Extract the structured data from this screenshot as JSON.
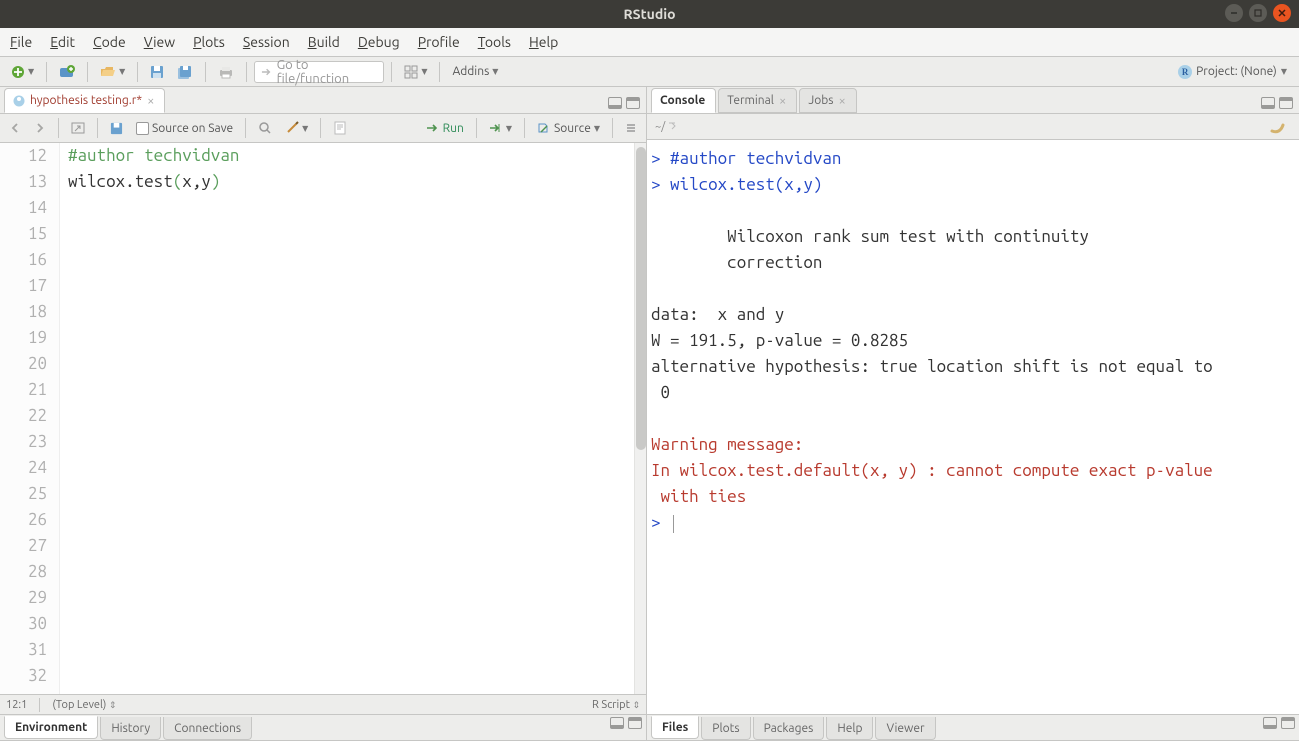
{
  "window": {
    "title": "RStudio"
  },
  "menubar": [
    "File",
    "Edit",
    "Code",
    "View",
    "Plots",
    "Session",
    "Build",
    "Debug",
    "Profile",
    "Tools",
    "Help"
  ],
  "toolbar": {
    "goto_placeholder": "Go to file/function",
    "addins_label": "Addins",
    "project_label": "Project: (None)"
  },
  "source": {
    "tab_name": "hypothesis testing.r*",
    "source_on_save": "Source on Save",
    "run_label": "Run",
    "source_label": "Source",
    "first_line": 12,
    "lines": [
      {
        "n": 12,
        "type": "comment",
        "text": "#author techvidvan"
      },
      {
        "n": 13,
        "type": "code",
        "text": "wilcox.test(x,y)"
      },
      {
        "n": 14,
        "type": "blank",
        "text": ""
      },
      {
        "n": 15,
        "type": "blank",
        "text": ""
      },
      {
        "n": 16,
        "type": "blank",
        "text": ""
      },
      {
        "n": 17,
        "type": "blank",
        "text": ""
      },
      {
        "n": 18,
        "type": "blank",
        "text": ""
      },
      {
        "n": 19,
        "type": "blank",
        "text": ""
      },
      {
        "n": 20,
        "type": "blank",
        "text": ""
      },
      {
        "n": 21,
        "type": "blank",
        "text": ""
      },
      {
        "n": 22,
        "type": "blank",
        "text": ""
      },
      {
        "n": 23,
        "type": "blank",
        "text": ""
      },
      {
        "n": 24,
        "type": "blank",
        "text": ""
      },
      {
        "n": 25,
        "type": "blank",
        "text": ""
      },
      {
        "n": 26,
        "type": "blank",
        "text": ""
      },
      {
        "n": 27,
        "type": "blank",
        "text": ""
      },
      {
        "n": 28,
        "type": "blank",
        "text": ""
      },
      {
        "n": 29,
        "type": "blank",
        "text": ""
      },
      {
        "n": 30,
        "type": "blank",
        "text": ""
      },
      {
        "n": 31,
        "type": "blank",
        "text": ""
      },
      {
        "n": 32,
        "type": "blank",
        "text": ""
      }
    ],
    "status_cursor": "12:1",
    "status_scope": "(Top Level)",
    "status_lang": "R Script"
  },
  "console": {
    "tabs": [
      "Console",
      "Terminal",
      "Jobs"
    ],
    "path": "~/",
    "lines": [
      {
        "cls": "prompt",
        "text": "> #author techvidvan"
      },
      {
        "cls": "prompt",
        "text": "> wilcox.test(x,y)"
      },
      {
        "cls": "out",
        "text": ""
      },
      {
        "cls": "out",
        "text": "        Wilcoxon rank sum test with continuity"
      },
      {
        "cls": "out",
        "text": "        correction"
      },
      {
        "cls": "out",
        "text": ""
      },
      {
        "cls": "out",
        "text": "data:  x and y"
      },
      {
        "cls": "out",
        "text": "W = 191.5, p-value = 0.8285"
      },
      {
        "cls": "out",
        "text": "alternative hypothesis: true location shift is not equal to"
      },
      {
        "cls": "out",
        "text": " 0"
      },
      {
        "cls": "out",
        "text": ""
      },
      {
        "cls": "warn",
        "text": "Warning message:"
      },
      {
        "cls": "warn",
        "text": "In wilcox.test.default(x, y) : cannot compute exact p-value"
      },
      {
        "cls": "warn",
        "text": " with ties"
      }
    ],
    "final_prompt": "> "
  },
  "bottom_left_tabs": [
    "Environment",
    "History",
    "Connections"
  ],
  "bottom_right_tabs": [
    "Files",
    "Plots",
    "Packages",
    "Help",
    "Viewer"
  ]
}
